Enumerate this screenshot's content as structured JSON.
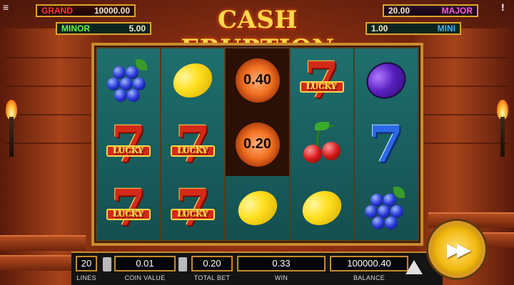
{
  "jackpots": {
    "grand": {
      "name": "GRAND",
      "value": "10000.00"
    },
    "minor": {
      "name": "MINOR",
      "value": "5.00"
    },
    "major": {
      "name": "MAJOR",
      "value": "20.00"
    },
    "mini": {
      "name": "MINI",
      "value": "1.00"
    }
  },
  "logo": "CASH ERUPTION",
  "reels": [
    [
      "grapes",
      "seven-lucky",
      "seven-lucky"
    ],
    [
      "lemon",
      "seven-lucky",
      "seven-lucky"
    ],
    [
      "fireball",
      "fireball",
      "lemon"
    ],
    [
      "seven-lucky",
      "cherry",
      "lemon"
    ],
    [
      "plum",
      "seven-blue",
      "grapes"
    ]
  ],
  "fireballs": {
    "reel3_row1": "0.40",
    "reel3_row2": "0.20"
  },
  "lucky_label": "LUCKY",
  "bottom": {
    "lines": {
      "value": "20",
      "label": "LINES"
    },
    "coin_value": {
      "value": "0.01",
      "label": "COIN VALUE"
    },
    "total_bet": {
      "value": "0.20",
      "label": "TOTAL BET"
    },
    "win": {
      "value": "0.33",
      "label": "WIN"
    },
    "balance": {
      "value": "100000.40",
      "label": "BALANCE"
    }
  },
  "spin_icon": "fast-forward-icon",
  "colors": {
    "grand": "#ff3a2a",
    "minor": "#5cff3a",
    "major": "#ff5cd9",
    "mini": "#3ab5ff",
    "frame": "#c98a2e",
    "spin": "#f2b811"
  }
}
